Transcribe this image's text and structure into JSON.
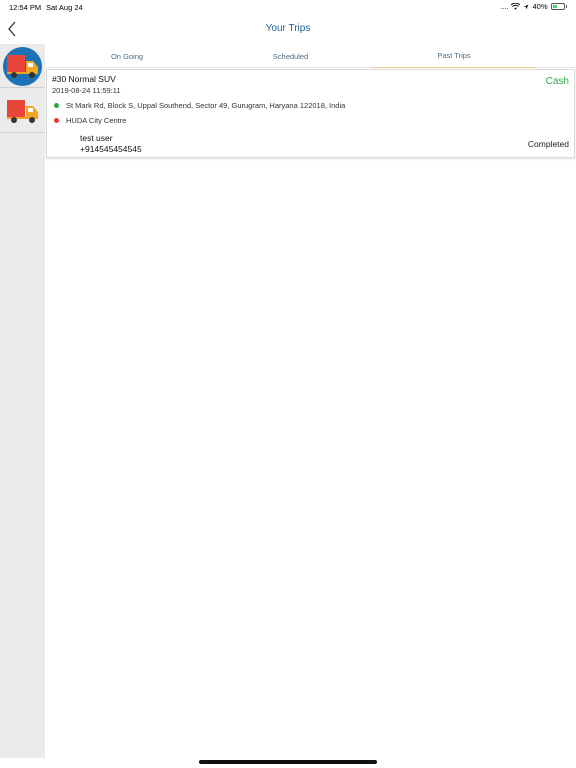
{
  "status_bar": {
    "time": "12:54 PM",
    "date": "Sat Aug 24",
    "signal": "....",
    "battery_pct": "40%",
    "battery_level": 0.4
  },
  "header": {
    "title": "Your Trips",
    "back_icon": "chevron-left-icon"
  },
  "sidebar": {
    "items": [
      {
        "icon": "truck-icon",
        "selected": true
      },
      {
        "icon": "truck-icon",
        "selected": false
      }
    ]
  },
  "tabs": [
    {
      "label": "On Going"
    },
    {
      "label": "Scheduled"
    },
    {
      "label": "Past Trips",
      "active": true
    }
  ],
  "trips": [
    {
      "id": "#30 Normal SUV",
      "datetime": "2019-08-24 11:59:11",
      "payment": "Cash",
      "pickup": "St Mark Rd, Block S, Uppal Southend, Sector 49, Gurugram, Haryana 122018, India",
      "drop": "HUDA City Centre",
      "driver_name": "test user",
      "driver_phone": "+914545454545",
      "status": "Completed"
    }
  ],
  "colors": {
    "accent": "#1f5f99",
    "cash": "#27a844",
    "pickup_dot": "#27a844",
    "drop_dot": "#e33b2e",
    "active_tab_underline": "#e9c98c",
    "truck_body": "#f0a623",
    "truck_cargo": "#e8463a"
  }
}
